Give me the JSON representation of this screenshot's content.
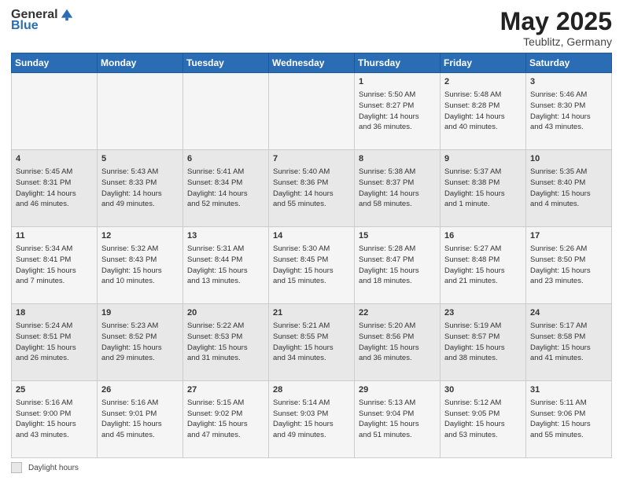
{
  "header": {
    "logo_general": "General",
    "logo_blue": "Blue",
    "title": "May 2025",
    "location": "Teublitz, Germany"
  },
  "days_of_week": [
    "Sunday",
    "Monday",
    "Tuesday",
    "Wednesday",
    "Thursday",
    "Friday",
    "Saturday"
  ],
  "weeks": [
    [
      {
        "day": "",
        "info": ""
      },
      {
        "day": "",
        "info": ""
      },
      {
        "day": "",
        "info": ""
      },
      {
        "day": "",
        "info": ""
      },
      {
        "day": "1",
        "info": "Sunrise: 5:50 AM\nSunset: 8:27 PM\nDaylight: 14 hours\nand 36 minutes."
      },
      {
        "day": "2",
        "info": "Sunrise: 5:48 AM\nSunset: 8:28 PM\nDaylight: 14 hours\nand 40 minutes."
      },
      {
        "day": "3",
        "info": "Sunrise: 5:46 AM\nSunset: 8:30 PM\nDaylight: 14 hours\nand 43 minutes."
      }
    ],
    [
      {
        "day": "4",
        "info": "Sunrise: 5:45 AM\nSunset: 8:31 PM\nDaylight: 14 hours\nand 46 minutes."
      },
      {
        "day": "5",
        "info": "Sunrise: 5:43 AM\nSunset: 8:33 PM\nDaylight: 14 hours\nand 49 minutes."
      },
      {
        "day": "6",
        "info": "Sunrise: 5:41 AM\nSunset: 8:34 PM\nDaylight: 14 hours\nand 52 minutes."
      },
      {
        "day": "7",
        "info": "Sunrise: 5:40 AM\nSunset: 8:36 PM\nDaylight: 14 hours\nand 55 minutes."
      },
      {
        "day": "8",
        "info": "Sunrise: 5:38 AM\nSunset: 8:37 PM\nDaylight: 14 hours\nand 58 minutes."
      },
      {
        "day": "9",
        "info": "Sunrise: 5:37 AM\nSunset: 8:38 PM\nDaylight: 15 hours\nand 1 minute."
      },
      {
        "day": "10",
        "info": "Sunrise: 5:35 AM\nSunset: 8:40 PM\nDaylight: 15 hours\nand 4 minutes."
      }
    ],
    [
      {
        "day": "11",
        "info": "Sunrise: 5:34 AM\nSunset: 8:41 PM\nDaylight: 15 hours\nand 7 minutes."
      },
      {
        "day": "12",
        "info": "Sunrise: 5:32 AM\nSunset: 8:43 PM\nDaylight: 15 hours\nand 10 minutes."
      },
      {
        "day": "13",
        "info": "Sunrise: 5:31 AM\nSunset: 8:44 PM\nDaylight: 15 hours\nand 13 minutes."
      },
      {
        "day": "14",
        "info": "Sunrise: 5:30 AM\nSunset: 8:45 PM\nDaylight: 15 hours\nand 15 minutes."
      },
      {
        "day": "15",
        "info": "Sunrise: 5:28 AM\nSunset: 8:47 PM\nDaylight: 15 hours\nand 18 minutes."
      },
      {
        "day": "16",
        "info": "Sunrise: 5:27 AM\nSunset: 8:48 PM\nDaylight: 15 hours\nand 21 minutes."
      },
      {
        "day": "17",
        "info": "Sunrise: 5:26 AM\nSunset: 8:50 PM\nDaylight: 15 hours\nand 23 minutes."
      }
    ],
    [
      {
        "day": "18",
        "info": "Sunrise: 5:24 AM\nSunset: 8:51 PM\nDaylight: 15 hours\nand 26 minutes."
      },
      {
        "day": "19",
        "info": "Sunrise: 5:23 AM\nSunset: 8:52 PM\nDaylight: 15 hours\nand 29 minutes."
      },
      {
        "day": "20",
        "info": "Sunrise: 5:22 AM\nSunset: 8:53 PM\nDaylight: 15 hours\nand 31 minutes."
      },
      {
        "day": "21",
        "info": "Sunrise: 5:21 AM\nSunset: 8:55 PM\nDaylight: 15 hours\nand 34 minutes."
      },
      {
        "day": "22",
        "info": "Sunrise: 5:20 AM\nSunset: 8:56 PM\nDaylight: 15 hours\nand 36 minutes."
      },
      {
        "day": "23",
        "info": "Sunrise: 5:19 AM\nSunset: 8:57 PM\nDaylight: 15 hours\nand 38 minutes."
      },
      {
        "day": "24",
        "info": "Sunrise: 5:17 AM\nSunset: 8:58 PM\nDaylight: 15 hours\nand 41 minutes."
      }
    ],
    [
      {
        "day": "25",
        "info": "Sunrise: 5:16 AM\nSunset: 9:00 PM\nDaylight: 15 hours\nand 43 minutes."
      },
      {
        "day": "26",
        "info": "Sunrise: 5:16 AM\nSunset: 9:01 PM\nDaylight: 15 hours\nand 45 minutes."
      },
      {
        "day": "27",
        "info": "Sunrise: 5:15 AM\nSunset: 9:02 PM\nDaylight: 15 hours\nand 47 minutes."
      },
      {
        "day": "28",
        "info": "Sunrise: 5:14 AM\nSunset: 9:03 PM\nDaylight: 15 hours\nand 49 minutes."
      },
      {
        "day": "29",
        "info": "Sunrise: 5:13 AM\nSunset: 9:04 PM\nDaylight: 15 hours\nand 51 minutes."
      },
      {
        "day": "30",
        "info": "Sunrise: 5:12 AM\nSunset: 9:05 PM\nDaylight: 15 hours\nand 53 minutes."
      },
      {
        "day": "31",
        "info": "Sunrise: 5:11 AM\nSunset: 9:06 PM\nDaylight: 15 hours\nand 55 minutes."
      }
    ]
  ],
  "legend": {
    "box_label": "Daylight hours"
  }
}
